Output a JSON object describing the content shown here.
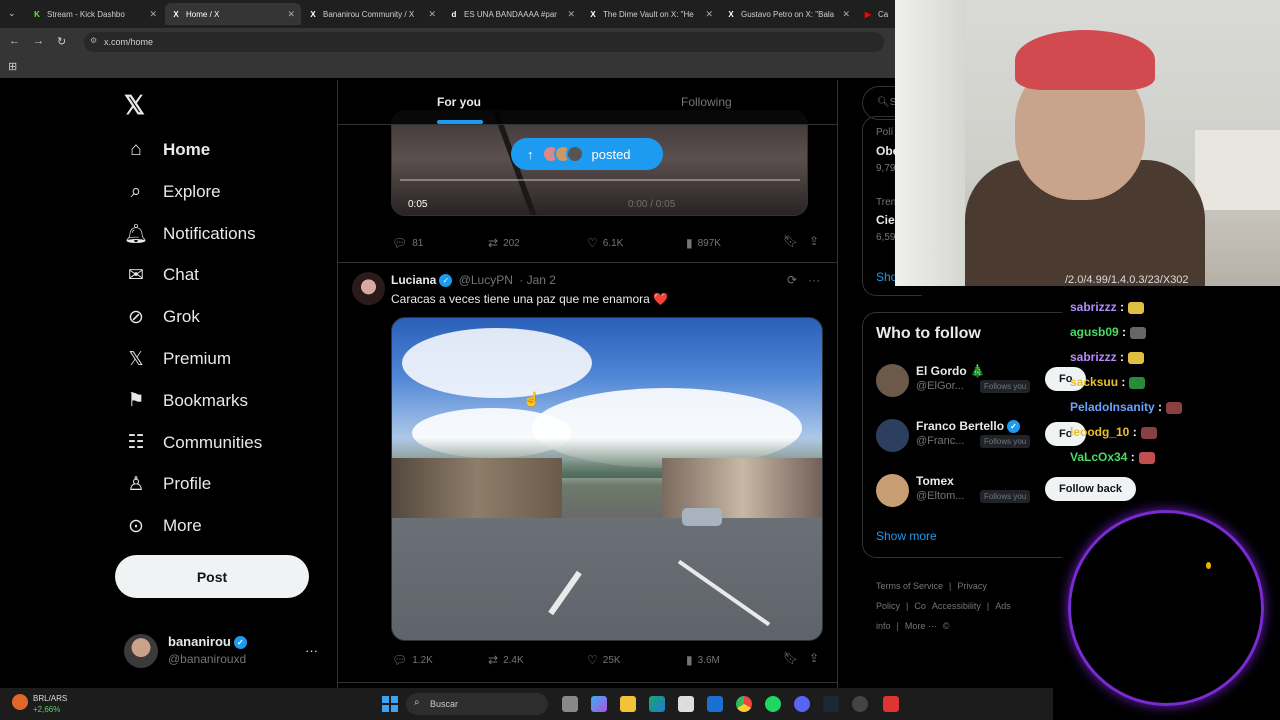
{
  "browser": {
    "tabs": [
      {
        "title": "Stream - Kick Dashbo",
        "fav": "K",
        "favColor": "#53fc18"
      },
      {
        "title": "Home / X",
        "fav": "X",
        "favColor": "#ffffff"
      },
      {
        "title": "Bananirou Community / X",
        "fav": "X",
        "favColor": "#ffffff"
      },
      {
        "title": "ES UNA BANDAAAA #par",
        "fav": "d",
        "favColor": "#ffffff"
      },
      {
        "title": "The Dime Vault on X: \"He",
        "fav": "X",
        "favColor": "#ffffff"
      },
      {
        "title": "Gustavo Petro on X: \"Bala",
        "fav": "X",
        "favColor": "#ffffff"
      },
      {
        "title": "Cayc",
        "fav": "▶",
        "favColor": "#ff0000"
      }
    ],
    "url": "x.com/home"
  },
  "nav": {
    "items": [
      {
        "label": "Home",
        "icon": "home-icon"
      },
      {
        "label": "Explore",
        "icon": "search-icon"
      },
      {
        "label": "Notifications",
        "icon": "bell-icon"
      },
      {
        "label": "Chat",
        "icon": "mail-icon"
      },
      {
        "label": "Grok",
        "icon": "grok-icon"
      },
      {
        "label": "Premium",
        "icon": "x-icon"
      },
      {
        "label": "Bookmarks",
        "icon": "bookmark-icon"
      },
      {
        "label": "Communities",
        "icon": "people-icon"
      },
      {
        "label": "Profile",
        "icon": "person-icon"
      },
      {
        "label": "More",
        "icon": "more-circle-icon"
      }
    ],
    "post_label": "Post",
    "account": {
      "name": "bananirou",
      "handle": "@bananirouxd"
    }
  },
  "feed": {
    "tabs": [
      "For you",
      "Following"
    ],
    "posted_pill": "posted",
    "video1": {
      "time": "0:05",
      "time_right": "0:00 / 0:05"
    },
    "post1_actions": {
      "replies": "81",
      "reposts": "202",
      "likes": "6.1K",
      "views": "897K"
    },
    "post2": {
      "name": "Luciana",
      "handle": "@LucyPN",
      "date": "· Jan 2",
      "text": "Caracas a veces tiene una paz que me enamora ❤️",
      "actions": {
        "replies": "1.2K",
        "reposts": "2.4K",
        "likes": "25K",
        "views": "3.6M"
      }
    }
  },
  "right": {
    "search_placeholder": "S",
    "trend_snips": [
      {
        "cat": "Polí",
        "title": "Obe",
        "count": "9,79"
      },
      {
        "cat": "Tren",
        "title": "Cie",
        "count": "6,59"
      }
    ],
    "show_snip": "Sho",
    "wtf_title": "Who to follow",
    "wtf": [
      {
        "name": "El Gordo 🎄",
        "handle": "@ElGor...",
        "follows": "Follows you",
        "btn": "Fo"
      },
      {
        "name": "Franco Bertello",
        "handle": "@Franc...",
        "follows": "Follows you",
        "btn": "Fo"
      },
      {
        "name": "Tomex",
        "handle": "@Eltom...",
        "follows": "Follows you",
        "btn": "Follow back"
      }
    ],
    "show_more": "Show more",
    "footer": [
      "Terms of Service",
      "|",
      "Privacy Policy",
      "|",
      "Co",
      "Accessibility",
      "|",
      "Ads info",
      "|",
      "More ···",
      "©"
    ]
  },
  "stream_chat": {
    "top_snip": "/2.0/4.99/1.4.0.3/23/X302",
    "lines": [
      {
        "user": "sabrizzz",
        "color": "#b48cff"
      },
      {
        "user": "agusb09",
        "color": "#4cd964"
      },
      {
        "user": "sabrizzz",
        "color": "#b48cff"
      },
      {
        "user": "sacksuu",
        "color": "#e6c02a"
      },
      {
        "user": "PeladoInsanity",
        "color": "#6aa2ff"
      },
      {
        "user": "leoodg_10",
        "color": "#e6c02a"
      },
      {
        "user": "VaLcOx34",
        "color": "#4cd964"
      }
    ],
    "sep": ":"
  },
  "taskbar": {
    "ticker": "BRL/ARS",
    "ticker_change": "+2,66%",
    "search": "Buscar"
  }
}
